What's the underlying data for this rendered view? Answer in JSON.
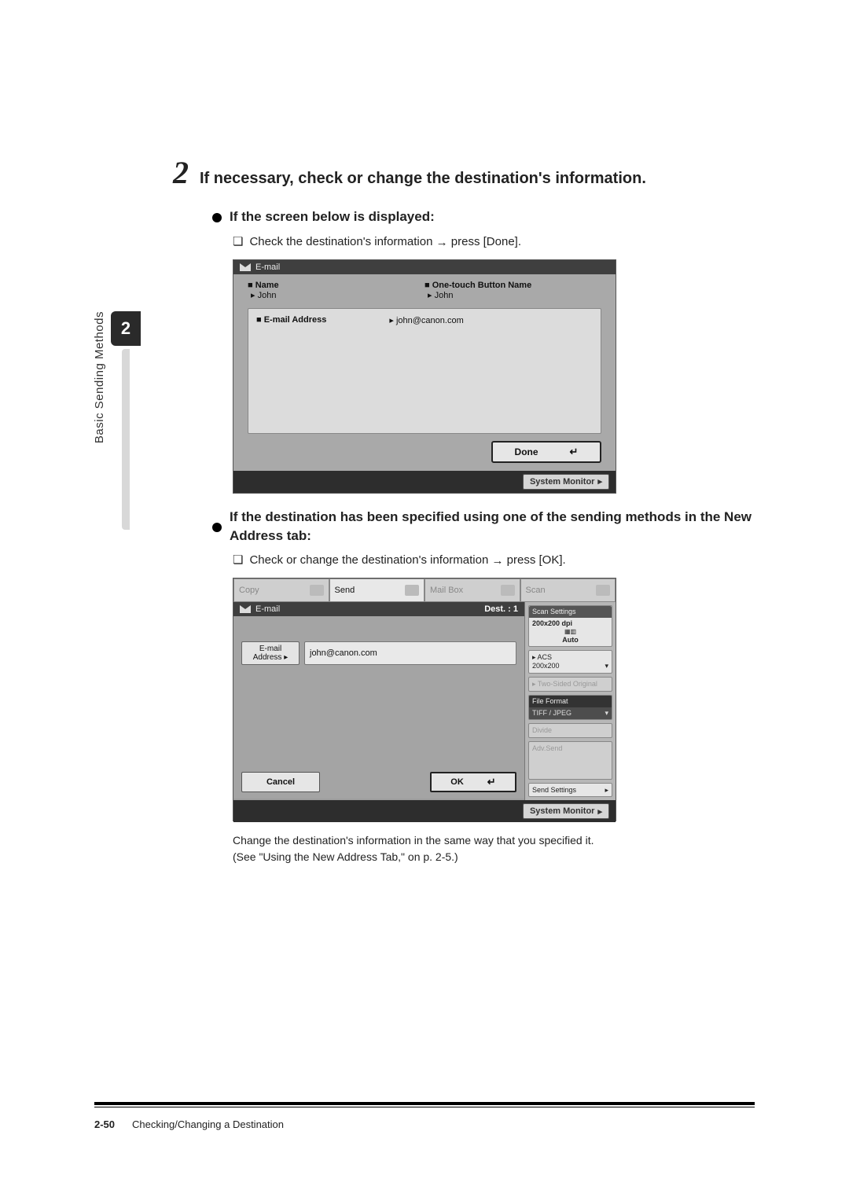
{
  "step": {
    "number": "2",
    "text": "If necessary, check or change the destination's information."
  },
  "case1": {
    "heading": "If the screen below is displayed:",
    "check_prefix": "Check the destination's information ",
    "check_suffix": " press [Done].",
    "arrow": "→"
  },
  "shot1": {
    "title": "E-mail",
    "name_label": "■ Name",
    "name_value": "John",
    "otb_label": "■ One-touch Button Name",
    "otb_value": "John",
    "email_label": "■ E-mail Address",
    "email_value": "john@canon.com",
    "done": "Done",
    "sysmon": "System Monitor"
  },
  "case2": {
    "heading": "If the destination has been specified using one of the sending methods in the New Address tab:",
    "check_prefix": "Check or change the destination's information ",
    "check_suffix": " press [OK].",
    "arrow": "→"
  },
  "shot2": {
    "tabs": {
      "copy": "Copy",
      "send": "Send",
      "mailbox": "Mail Box",
      "scan": "Scan"
    },
    "title": "E-mail",
    "dest": "Dest. : 1",
    "addr_btn_l1": "E-mail",
    "addr_btn_l2": "Address",
    "addr_val": "john@canon.com",
    "cancel": "Cancel",
    "ok": "OK",
    "sysmon": "System Monitor",
    "right": {
      "scan_settings": "Scan Settings",
      "res": "200x200 dpi",
      "mode": "Auto",
      "acs_l1": "ACS",
      "acs_l2": "200x200",
      "two_sided": "Two-Sided Original",
      "file_format": "File Format",
      "ff_val": "TIFF / JPEG",
      "divide": "Divide",
      "adv_send": "Adv.Send",
      "send_settings": "Send Settings"
    }
  },
  "note": {
    "line1": "Change the destination's information in the same way that you specified it.",
    "line2": "(See \"Using the New Address Tab,\" on p. 2-5.)"
  },
  "sidebar": {
    "chapter": "2",
    "label": "Basic Sending Methods"
  },
  "footer": {
    "page": "2-50",
    "title": "Checking/Changing a Destination"
  },
  "glyph": {
    "checkbox": "❏",
    "return": "↵",
    "tri": "▸",
    "dropdown": "▾",
    "chev": "▸"
  }
}
